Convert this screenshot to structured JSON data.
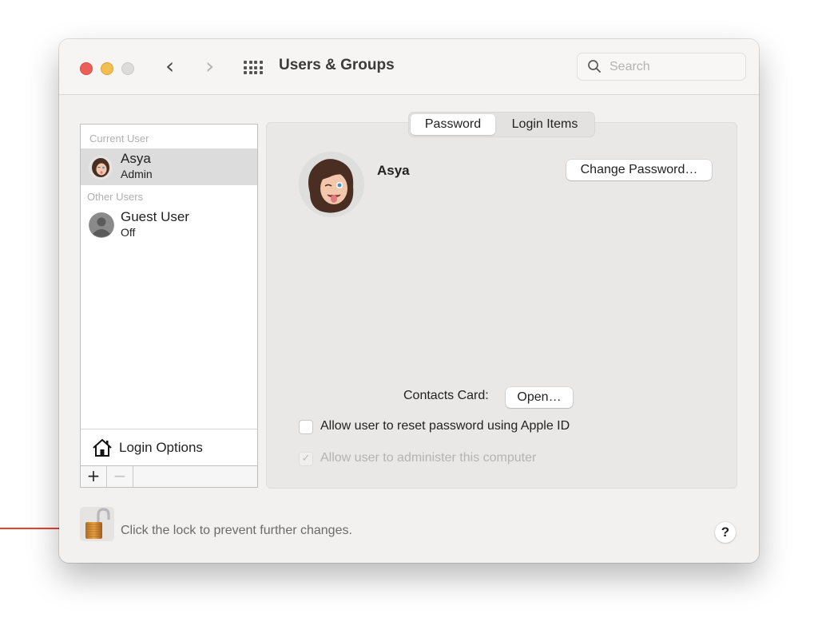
{
  "window": {
    "title": "Users & Groups",
    "search": {
      "placeholder": "Search",
      "value": ""
    }
  },
  "sidebar": {
    "sections": [
      {
        "label": "Current User",
        "users": [
          {
            "name": "Asya",
            "role": "Admin",
            "selected": true,
            "avatar": "memoji-avatar"
          }
        ]
      },
      {
        "label": "Other Users",
        "users": [
          {
            "name": "Guest User",
            "role": "Off",
            "selected": false,
            "avatar": "generic-person-avatar"
          }
        ]
      }
    ],
    "login_options_label": "Login Options",
    "add_label": "+",
    "remove_label": "−"
  },
  "pane": {
    "tabs": [
      {
        "label": "Password",
        "active": true
      },
      {
        "label": "Login Items",
        "active": false
      }
    ],
    "user_name": "Asya",
    "change_password_label": "Change Password…",
    "contacts_card_label": "Contacts Card:",
    "open_label": "Open…",
    "checkboxes": [
      {
        "label": "Allow user to reset password using Apple ID",
        "checked": false,
        "enabled": true
      },
      {
        "label": "Allow user to administer this computer",
        "checked": true,
        "enabled": false,
        "mark": "✓"
      }
    ]
  },
  "footer": {
    "lock_state": "unlocked",
    "lock_text": "Click the lock to prevent further changes.",
    "help_label": "?"
  },
  "annotation": {
    "type": "arrow",
    "color": "#e8412c",
    "points_to": "lock-button"
  },
  "colors": {
    "close": "#ec5f57",
    "minimize": "#f4bd4f",
    "zoom_disabled": "#dcdbda",
    "selection": "#dcdcdc",
    "annotation_arrow": "#e8412c"
  }
}
